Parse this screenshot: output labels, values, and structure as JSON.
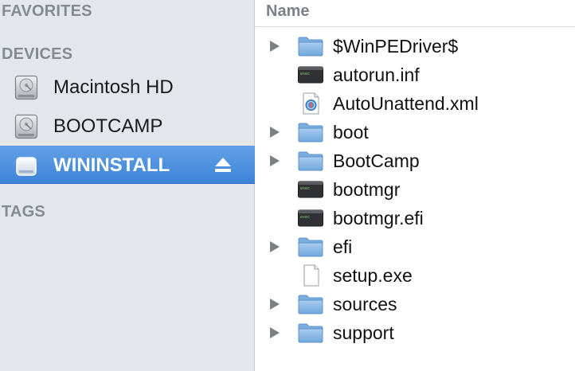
{
  "sidebar": {
    "favorites_header": "FAVORITES",
    "devices_header": "DEVICES",
    "tags_header": "TAGS",
    "devices": [
      {
        "label": "Macintosh HD",
        "icon": "hard-drive-icon",
        "selected": false
      },
      {
        "label": "BOOTCAMP",
        "icon": "hard-drive-icon",
        "selected": false
      },
      {
        "label": "WININSTALL",
        "icon": "external-drive-icon",
        "selected": true
      }
    ]
  },
  "list": {
    "column_name": "Name",
    "items": [
      {
        "name": "$WinPEDriver$",
        "type": "folder",
        "expandable": true
      },
      {
        "name": "autorun.inf",
        "type": "executable",
        "expandable": false
      },
      {
        "name": "AutoUnattend.xml",
        "type": "xml-file",
        "expandable": false
      },
      {
        "name": "boot",
        "type": "folder",
        "expandable": true
      },
      {
        "name": "BootCamp",
        "type": "folder",
        "expandable": true
      },
      {
        "name": "bootmgr",
        "type": "executable",
        "expandable": false
      },
      {
        "name": "bootmgr.efi",
        "type": "executable",
        "expandable": false
      },
      {
        "name": "efi",
        "type": "folder",
        "expandable": true
      },
      {
        "name": "setup.exe",
        "type": "document",
        "expandable": false
      },
      {
        "name": "sources",
        "type": "folder",
        "expandable": true
      },
      {
        "name": "support",
        "type": "folder",
        "expandable": true
      }
    ]
  },
  "colors": {
    "sidebar_bg": "#e3e7ec",
    "selection": "#3d83d8",
    "folder_blue": "#8ab8e2"
  }
}
